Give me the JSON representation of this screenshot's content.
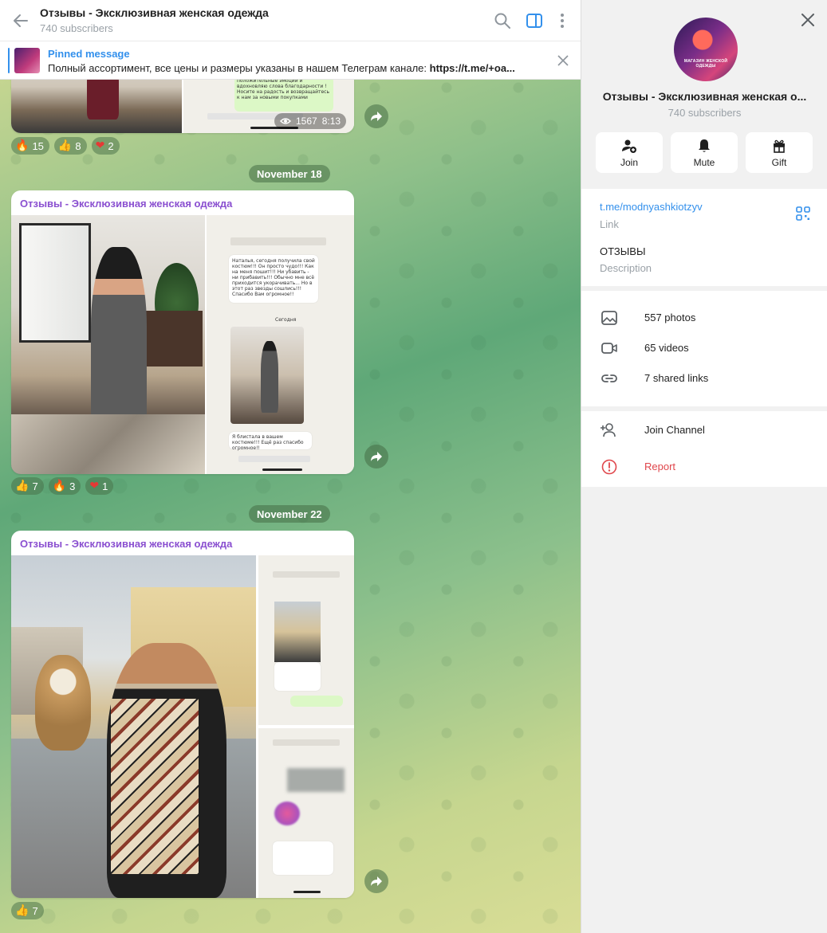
{
  "header": {
    "title": "Отзывы - Эксклюзивная женская одежда",
    "subtitle": "740 subscribers"
  },
  "pinned": {
    "title": "Pinned message",
    "text": "Полный ассортимент, все цены и размеры указаны в нашем Телеграм канале: ",
    "link": "https://t.me/+oa..."
  },
  "post_top": {
    "views": "1567",
    "time": "8:13",
    "screenshot_text": "положительные эмоции и вдохновляю слова благодарности ! Носите на радость и возвращайтесь к нам за новыми покупками",
    "reactions": [
      {
        "emoji": "🔥",
        "count": "15"
      },
      {
        "emoji": "👍",
        "count": "8"
      },
      {
        "emoji": "❤",
        "count": "2"
      }
    ]
  },
  "dates": {
    "d1": "November 18",
    "d2": "November 22"
  },
  "post_nov18": {
    "author": "Отзывы - Эксклюзивная женская одежда",
    "screenshot_text_1": "Наталья, сегодня получила свой костюм!!! Он просто чудо!!! Как на меня пошит!!! Ни убавить - ни прибавить!!! Обычно мне всё приходится укорачивать... Но в этот раз звезды сошлись!!! Спасибо Вам огромное!!",
    "screenshot_sub": "Сегодня",
    "screenshot_text_2": "Я блистала в вашем костюме!!! Ещё раз спасибо огромное!!",
    "reactions": [
      {
        "emoji": "👍",
        "count": "7"
      },
      {
        "emoji": "🔥",
        "count": "3"
      },
      {
        "emoji": "❤",
        "count": "1"
      }
    ]
  },
  "post_nov22": {
    "author": "Отзывы - Эксклюзивная женская одежда",
    "reactions": [
      {
        "emoji": "👍",
        "count": "7"
      }
    ]
  },
  "panel": {
    "name": "Отзывы - Эксклюзивная женская о...",
    "subscribers": "740 subscribers",
    "avatar_caption": "МАГАЗИН ЖЕНСКОЙ ОДЕЖДЫ",
    "actions": [
      {
        "label": "Join",
        "icon": "add-user-icon"
      },
      {
        "label": "Mute",
        "icon": "bell-icon"
      },
      {
        "label": "Gift",
        "icon": "gift-icon"
      }
    ],
    "link_value": "t.me/modnyashkiotzyv",
    "link_label": "Link",
    "description_value": "ОТЗЫВЫ",
    "description_label": "Description",
    "media": [
      {
        "label": "557 photos",
        "icon": "photo-icon"
      },
      {
        "label": "65 videos",
        "icon": "video-icon"
      },
      {
        "label": "7 shared links",
        "icon": "link-icon"
      }
    ],
    "join_channel": "Join Channel",
    "report": "Report",
    "accent_color": "#3390ec",
    "danger_color": "#e0474c",
    "author_color": "#8a4fd0"
  }
}
